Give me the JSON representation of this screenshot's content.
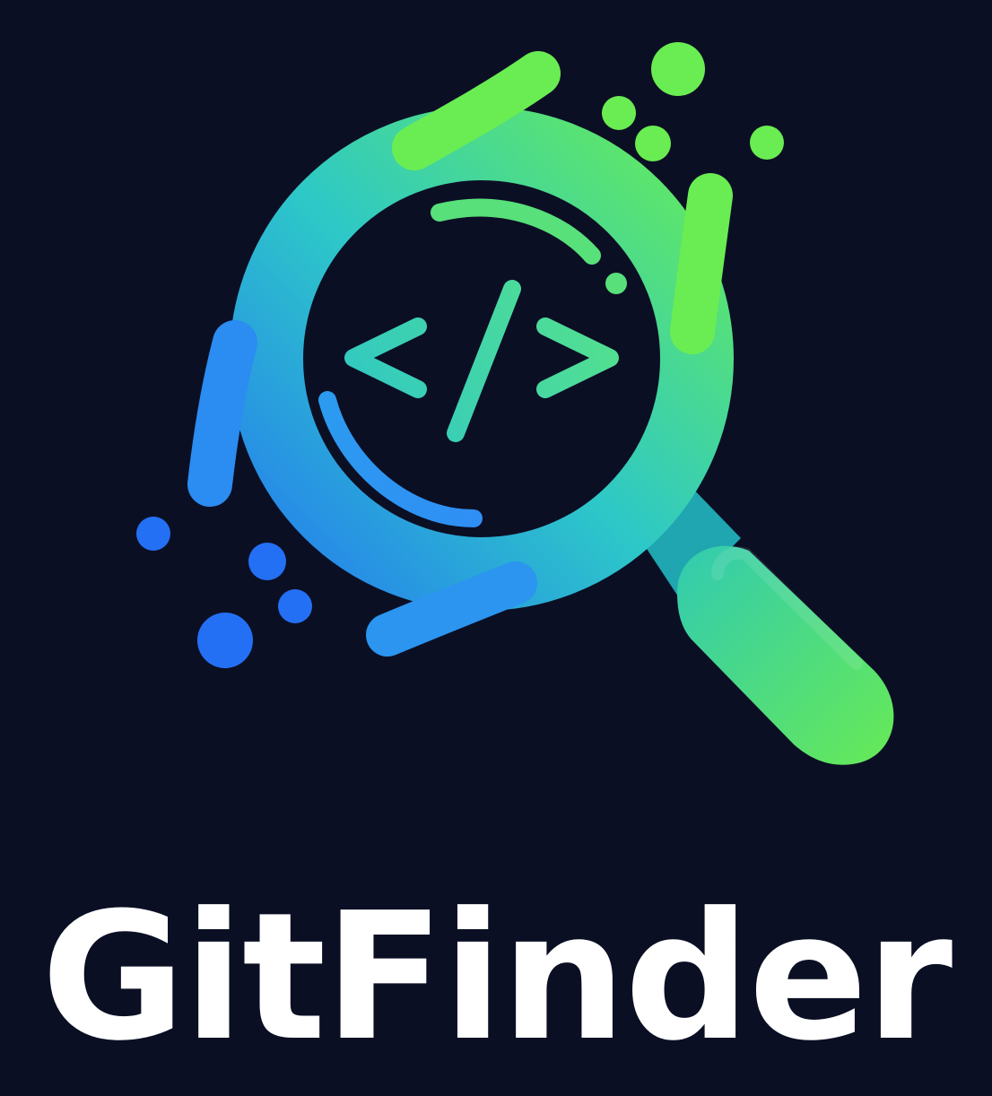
{
  "brand": {
    "name": "GitFinder",
    "code_symbol": "</>",
    "colors": {
      "background": "#0b0f24",
      "blue": "#2470f5",
      "cyan": "#2dc8c8",
      "green": "#6aed52",
      "text": "#ffffff"
    }
  },
  "logo": {
    "icon": "magnifier-code-icon"
  }
}
